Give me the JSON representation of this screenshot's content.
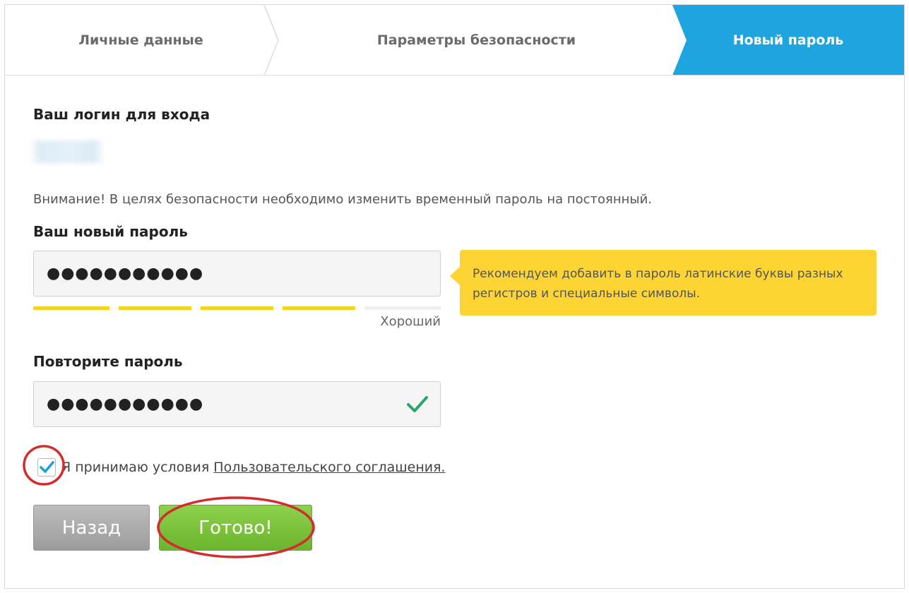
{
  "stepper": {
    "steps": [
      {
        "label": "Личные данные"
      },
      {
        "label": "Параметры безопасности"
      },
      {
        "label": "Новый пароль"
      }
    ],
    "active_color": "#1aa3df"
  },
  "login": {
    "heading": "Ваш логин для входа"
  },
  "notice": "Внимание! В целях безопасности необходимо изменить временный пароль на постоянный.",
  "new_password": {
    "label": "Ваш новый пароль",
    "value": "●●●●●●●●●●●",
    "strength_text": "Хороший",
    "strength_segments_filled": 4,
    "strength_segments_total": 5,
    "strength_color": "#f5d31f"
  },
  "tooltip": {
    "text": "Рекомендуем добавить в пароль латинские буквы разных регистров и специальные символы."
  },
  "repeat_password": {
    "label": "Повторите пароль",
    "value": "●●●●●●●●●●●",
    "match_icon": "checkmark-icon"
  },
  "agreement": {
    "checked": true,
    "text": "Я принимаю условия",
    "link_text": "Пользовательского соглашения."
  },
  "buttons": {
    "back": "Назад",
    "done": "Готово!"
  },
  "annotation_color": "#d42b2b"
}
